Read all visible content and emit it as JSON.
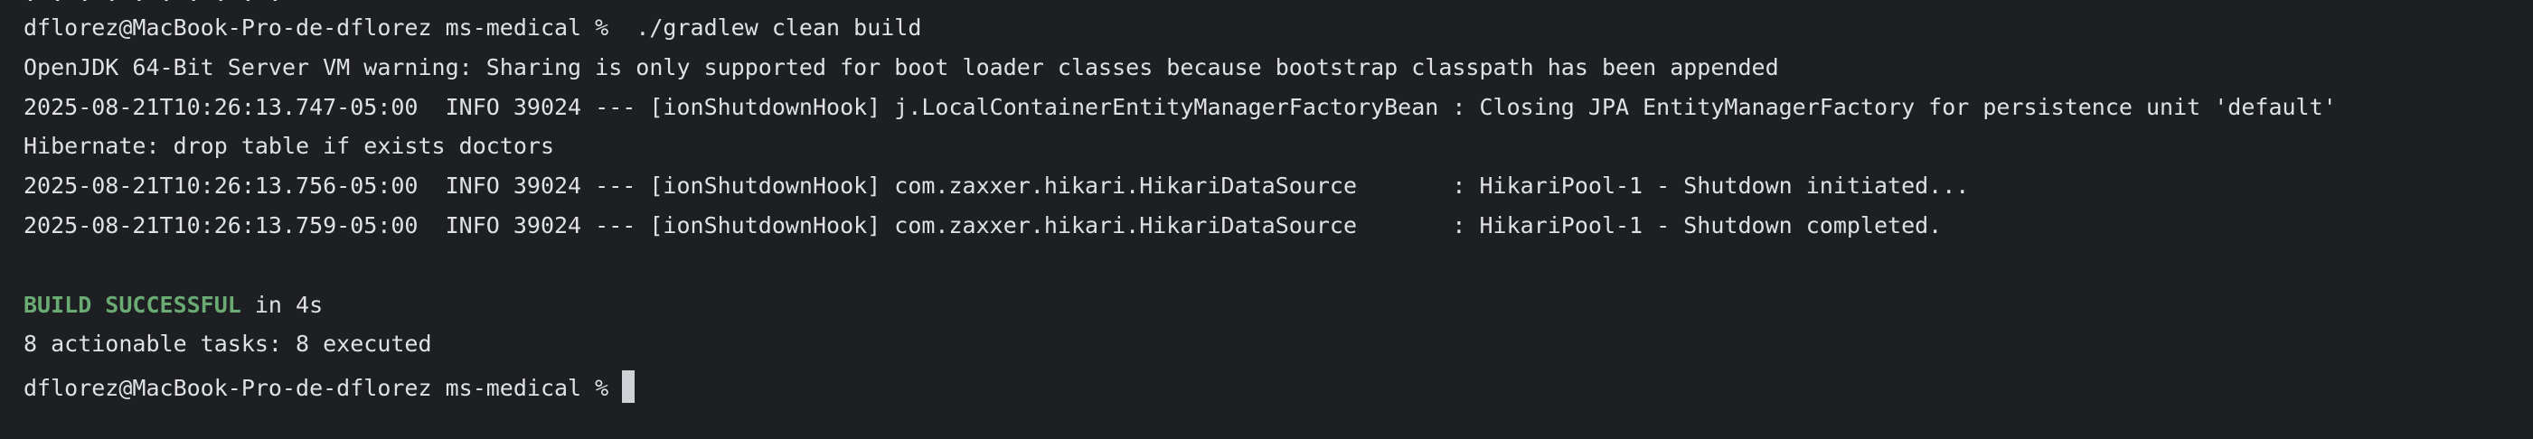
{
  "terminal": {
    "clipped_top": ". . . . . . . . . .",
    "lines": {
      "cmd_prompt": "dflorez@MacBook-Pro-de-dflorez ms-medical %",
      "cmd_text": "  ./gradlew clean build",
      "jdk_warning": "OpenJDK 64-Bit Server VM warning: Sharing is only supported for boot loader classes because bootstrap classpath has been appended",
      "log1": "2025-08-21T10:26:13.747-05:00  INFO 39024 --- [ionShutdownHook] j.LocalContainerEntityManagerFactoryBean : Closing JPA EntityManagerFactory for persistence unit 'default'",
      "hibernate": "Hibernate: drop table if exists doctors",
      "log2": "2025-08-21T10:26:13.756-05:00  INFO 39024 --- [ionShutdownHook] com.zaxxer.hikari.HikariDataSource       : HikariPool-1 - Shutdown initiated...",
      "log3": "2025-08-21T10:26:13.759-05:00  INFO 39024 --- [ionShutdownHook] com.zaxxer.hikari.HikariDataSource       : HikariPool-1 - Shutdown completed.",
      "build_status": "BUILD SUCCESSFUL",
      "build_time": " in 4s",
      "tasks": "8 actionable tasks: 8 executed",
      "final_prompt": "dflorez@MacBook-Pro-de-dflorez ms-medical % "
    },
    "colors": {
      "background": "#1e1f22",
      "text": "#dfe1e5",
      "success": "#6aab73",
      "cursor": "#cfd1d6"
    }
  }
}
